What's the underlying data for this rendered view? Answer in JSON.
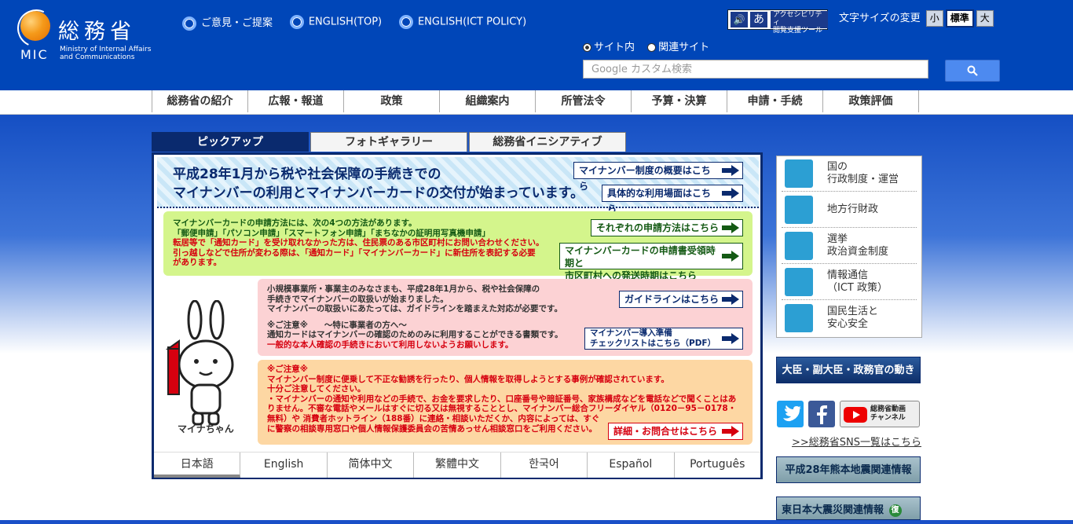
{
  "header": {
    "logo_title": "総務省",
    "logo_mic": "MIC",
    "logo_en_line1": "Ministry of Internal Affairs",
    "logo_en_line2": "and Communications",
    "top_links": [
      "ご意見・ご提案",
      "ENGLISH(TOP)",
      "ENGLISH(ICT POLICY)"
    ],
    "accessibility_label_1": "アクセシビリティ",
    "accessibility_label_2": "閲覧支援ツール",
    "font_size_label": "文字サイズの変更",
    "font_sizes": [
      "小",
      "標準",
      "大"
    ],
    "font_size_selected": "標準",
    "search_scope": [
      "サイト内",
      "関連サイト"
    ],
    "search_scope_selected": "サイト内",
    "search_placeholder": "Google カスタム検索"
  },
  "global_nav": [
    "総務省の紹介",
    "広報・報道",
    "政策",
    "組織案内",
    "所管法令",
    "予算・決算",
    "申請・手続",
    "政策評価"
  ],
  "tabs": [
    "ピックアップ",
    "フォトギャラリー",
    "総務省イニシアティブ"
  ],
  "tab_selected": "ピックアップ",
  "banner": {
    "title_line1": "平成28年1月から税や社会保障の手続きでの",
    "title_line2": "マイナンバーの利用とマイナンバーカードの交付が始まっています。",
    "btn_overview": "マイナンバー制度の概要はこちら",
    "btn_usage": "具体的な利用場面はこちら"
  },
  "green_box": {
    "line1": "マイナンバーカードの申請方法には、次の4つの方法があります。",
    "line2": "「郵便申請」「パソコン申請」「スマートフォン申請」「まちなかの証明用写真機申請」",
    "line3": "転居等で「通知カード」を受け取れなかった方は、住民票のある市区町村にお問い合わせください。",
    "line4": "引っ越しなどで住所が変わる際は、「通知カード」「マイナンバーカード」に新住所を表記する必要",
    "line5": "があります。",
    "btn_methods": "それぞれの申請方法はこちら",
    "btn_schedule_1": "マイナンバーカードの申請書受領時期と",
    "btn_schedule_2": "市区町村への発送時期はこちら"
  },
  "pink_box": {
    "line1": "小規模事業所・事業主のみなさまも、平成28年1月から、税や社会保障の",
    "line2": "手続きでマイナンバーの取扱いが始まりました。",
    "line3": "マイナンバーの取扱いにあたっては、ガイドラインを踏まえた対応が必要です。",
    "line4": "※ご注意※　　～特に事業者の方へ～",
    "line5": "通知カードはマイナンバーの確認のためのみに利用することができる書類です。",
    "line6": "一般的な本人確認の手続きにおいて利用しないようお願いします。",
    "btn_guideline": "ガイドラインはこちら",
    "btn_checklist_1": "マイナンバー導入準備",
    "btn_checklist_2": "チェックリストはこちら（PDF）"
  },
  "orange_box": {
    "line1": "※ご注意※",
    "line2": "マイナンバー制度に便乗して不正な勧誘を行ったり、個人情報を取得しようとする事例が確認されています。",
    "line3": "十分ご注意してください。",
    "line4": "・マイナンバーの通知や利用などの手続で、お金を要求したり、口座番号や暗証番号、家族構成などを電話などで聞くことはあ",
    "line5": "りません。不審な電話やメールはすぐに切る又は無視することとし、マイナンバー総合フリーダイヤル（0120－95－0178・",
    "line6": "無料）や 消費者ホットライン（188番）に連絡・相談いただくか、内容によっては、すぐ",
    "line7": "に警察の相談専用窓口や個人情報保護委員会の苦情あっせん相談窓口をご利用ください。",
    "btn_contact": "詳細・お問合せはこちら"
  },
  "mascot_name": "マイナちゃん",
  "languages": [
    "日本語",
    "English",
    "简体中文",
    "繁體中文",
    "한국어",
    "Español",
    "Português"
  ],
  "language_selected": "日本語",
  "sidebar": {
    "items": [
      {
        "label_1": "国の",
        "label_2": "行政制度・運営",
        "icon": "building-icon"
      },
      {
        "label_1": "地方行財政",
        "label_2": "",
        "icon": "city-hall-icon"
      },
      {
        "label_1": "選挙",
        "label_2": "政治資金制度",
        "icon": "ballot-box-icon"
      },
      {
        "label_1": "情報通信",
        "label_2": "（ICT 政策）",
        "icon": "globe-icon"
      },
      {
        "label_1": "国民生活と",
        "label_2": "安心安全",
        "icon": "family-icon"
      }
    ],
    "minister_banner": "大臣・副大臣・政務官の動き",
    "youtube_label_1": "総務省動画",
    "youtube_label_2": "チャンネル",
    "sns_link": ">>総務省SNS一覧はこちら",
    "kumamoto_banner": "平成28年熊本地震関連情報",
    "tohoku_banner": "東日本大震災関連情報",
    "tohoku_badge": "復"
  },
  "colors": {
    "header_blue": "#0046b8",
    "navy": "#0a2a6e",
    "alert_red": "#d6000f",
    "icon_cyan": "#2c9fd3"
  }
}
